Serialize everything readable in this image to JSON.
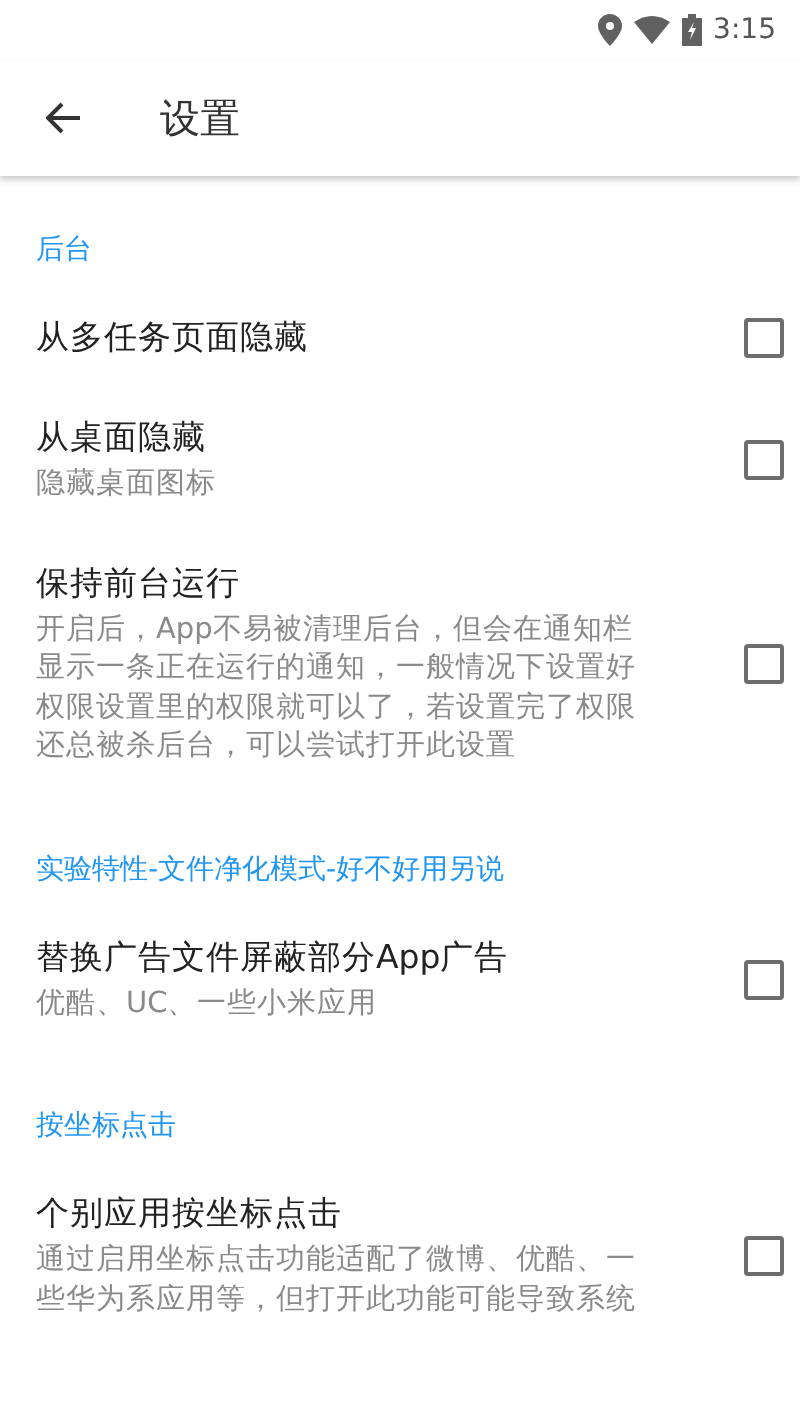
{
  "status_bar": {
    "time": "3:15"
  },
  "toolbar": {
    "title": "设置"
  },
  "sections": [
    {
      "header": "后台",
      "items": [
        {
          "title": "从多任务页面隐藏",
          "checked": false
        },
        {
          "title": "从桌面隐藏",
          "summary": "隐藏桌面图标",
          "checked": false
        },
        {
          "title": "保持前台运行",
          "summary": "开启后，App不易被清理后台，但会在通知栏显示一条正在运行的通知，一般情况下设置好权限设置里的权限就可以了，若设置完了权限还总被杀后台，可以尝试打开此设置",
          "checked": false
        }
      ]
    },
    {
      "header": "实验特性-文件净化模式-好不好用另说",
      "items": [
        {
          "title": "替换广告文件屏蔽部分App广告",
          "summary": "优酷、UC、一些小米应用",
          "checked": false
        }
      ]
    },
    {
      "header": "按坐标点击",
      "items": [
        {
          "title": "个别应用按坐标点击",
          "summary": "通过启用坐标点击功能适配了微博、优酷、一些华为系应用等，但打开此功能可能导致系统",
          "checked": false
        }
      ]
    }
  ]
}
